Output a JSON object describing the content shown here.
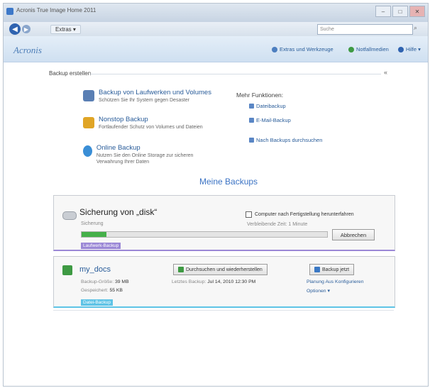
{
  "window": {
    "title": "Acronis True Image Home 2011",
    "controls": [
      "–",
      "□",
      "✕"
    ]
  },
  "nav": {
    "menu_label": "Extras ▾",
    "search_placeholder": "Suche"
  },
  "header": {
    "logo": "Acronis",
    "links": [
      {
        "label": "Extras und Werkzeuge",
        "icon": "tools-icon"
      },
      {
        "label": "Notfallmedien",
        "icon": "disc-icon"
      },
      {
        "label": "Hilfe ▾",
        "icon": "help-icon"
      }
    ]
  },
  "section": {
    "title": "Backup erstellen",
    "collapse": "«"
  },
  "tasks": [
    {
      "title": "Backup von Laufwerken und Volumes",
      "desc": "Schützen Sie Ihr System gegen Desaster"
    },
    {
      "title": "Nonstop Backup",
      "desc": "Fortlaufender Schutz von Volumes und Dateien"
    },
    {
      "title": "Online Backup",
      "desc": "Nutzen Sie den Online Storage zur sicheren Verwahrung Ihrer Daten"
    }
  ],
  "more": {
    "title": "Mehr Funktionen:",
    "links": [
      "Dateibackup",
      "E-Mail-Backup",
      "Nach Backups durchsuchen"
    ]
  },
  "my_backups_title": "Meine Backups",
  "backup1": {
    "title": "Sicherung von „disk“",
    "sub": "Sicherung",
    "checkbox_label": "Computer nach Fertigstellung herunterfahren",
    "remaining": "Verbleibende Zeit: 1 Minute",
    "progress": 0.1,
    "cancel_label": "Abbrechen",
    "tag": "Laufwerk-Backup"
  },
  "backup2": {
    "title": "my_docs",
    "size_label": "Backup-Größe:",
    "size_value": "39 MB",
    "saved_label": "Gespeichert:",
    "saved_value": "55 KB",
    "last_label": "Letztes Backup:",
    "last_value": "Jul 14, 2010 12:30 PM",
    "restore_btn": "Durchsuchen und wiederherstellen",
    "backup_btn": "Backup jetzt",
    "links_line1": "Planung  Aus  Konfigurieren",
    "links_line2": "Optionen ▾",
    "tag": "Datei-Backup"
  },
  "colors": {
    "accent": "#3b73c4",
    "progress": "#45b04a",
    "tag_disk": "#9b88d6",
    "tag_file": "#5ec3e6"
  }
}
